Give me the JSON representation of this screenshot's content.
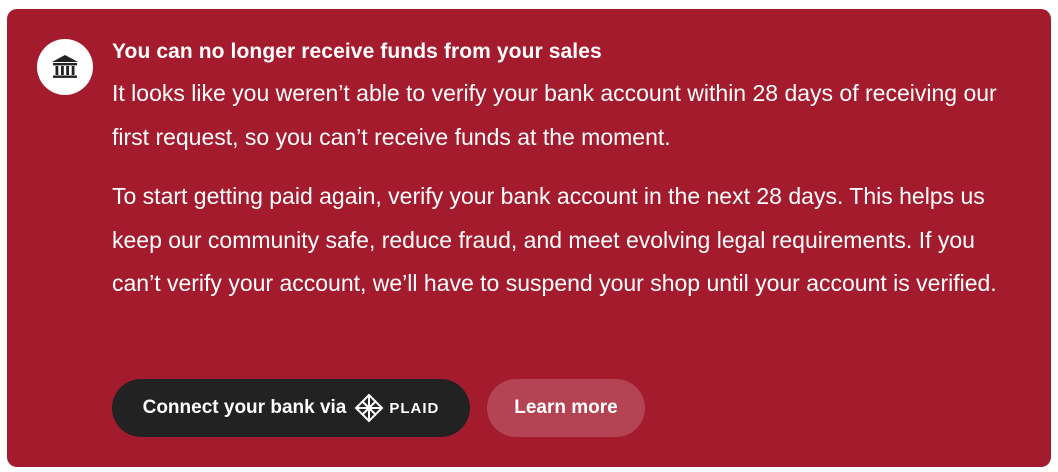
{
  "alert": {
    "icon": "bank-icon",
    "title": "You can no longer receive funds from your sales",
    "paragraph1": "It looks like you weren’t able to verify your bank account within 28 days of receiving our first request, so you can’t receive funds at the moment.",
    "paragraph2": "To start getting paid again, verify your bank account in the next 28 days. This helps us keep our community safe, reduce fraud, and meet evolving legal requirements. If you can’t verify your account, we’ll have to suspend your shop until your account is verified.",
    "background_color": "#a41b2e"
  },
  "actions": {
    "connect_label": "Connect your bank via",
    "plaid_label": "PLAID",
    "plaid_icon": "plaid-logo-icon",
    "learn_more_label": "Learn more"
  }
}
